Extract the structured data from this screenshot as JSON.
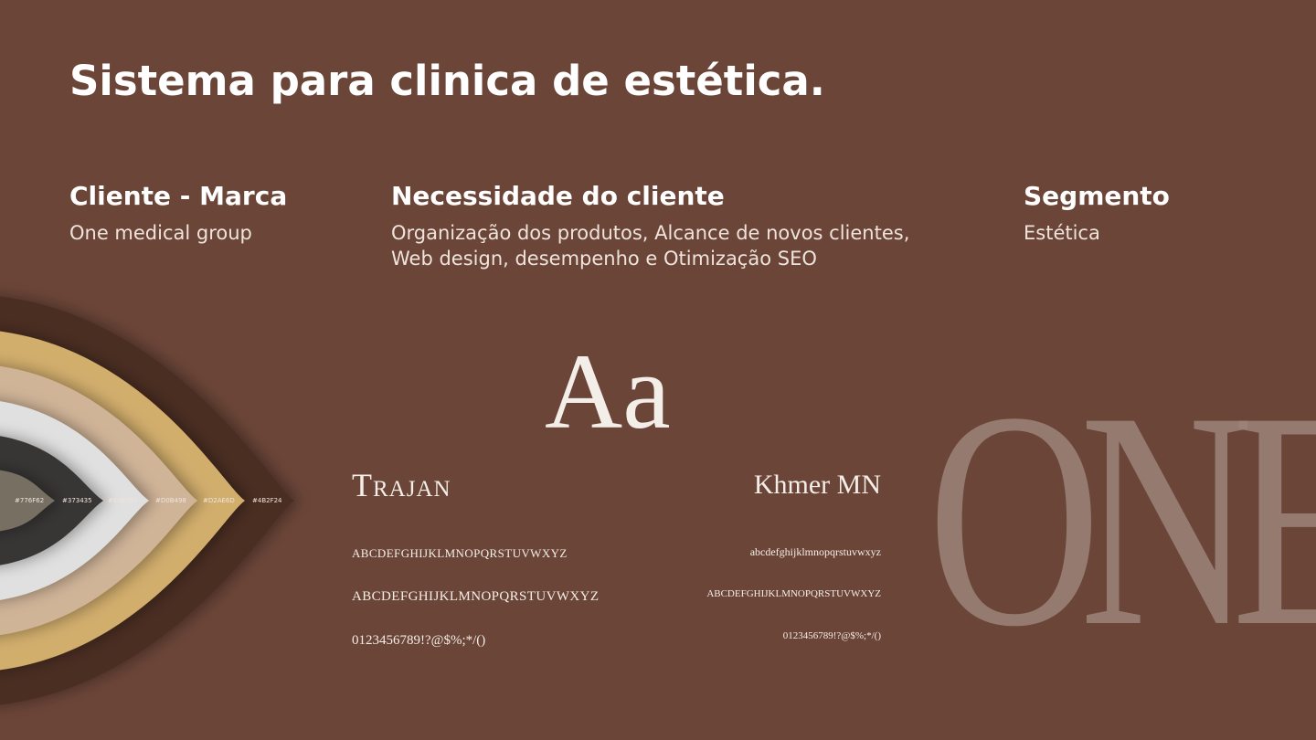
{
  "title": "Sistema para clinica de estética.",
  "info": {
    "client": {
      "heading": "Cliente - Marca",
      "text": "One medical group"
    },
    "need": {
      "heading": "Necessidade do cliente",
      "line1": "Organização dos produtos, Alcance de novos clientes,",
      "line2": "Web design, desempenho e Otimização SEO"
    },
    "segment": {
      "heading": "Segmento",
      "text": "Estética"
    }
  },
  "palette": [
    {
      "hex": "#4B2F24",
      "label": "#4B2F24"
    },
    {
      "hex": "#D2AE6D",
      "label": "#D2AE6D"
    },
    {
      "hex": "#D0B498",
      "label": "#D0B498"
    },
    {
      "hex": "#E0E0E0",
      "label": "#E0E0E0"
    },
    {
      "hex": "#373435",
      "label": "#373435"
    },
    {
      "hex": "#776F62",
      "label": "#776F62"
    }
  ],
  "typography": {
    "sample_glyph": "Aa",
    "trajan": {
      "name": "Trajan",
      "line1": "ABCDEFGHIJKLMNOPQRSTUVWXYZ",
      "line2": "ABCDEFGHIJKLMNOPQRSTUVWXYZ",
      "line3": "0123456789!?@$%;*/()"
    },
    "khmer": {
      "name": "Khmer MN",
      "line1": "abcdefghijklmnopqrstuvwxyz",
      "line2": "ABCDEFGHIJKLMNOPQRSTUVWXYZ",
      "line3": "0123456789!?@$%;*/()"
    }
  },
  "logo": {
    "text": "ONE",
    "color": "#9C847A"
  }
}
